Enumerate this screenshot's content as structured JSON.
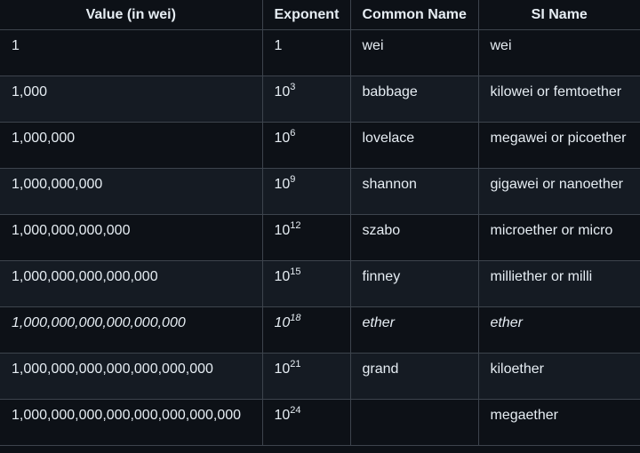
{
  "table": {
    "headers": [
      "Value (in wei)",
      "Exponent",
      "Common Name",
      "SI Name"
    ],
    "rows": [
      {
        "value": "1",
        "exp_base": "1",
        "exp_power": "",
        "common": "wei",
        "si": "wei",
        "emphasis": false
      },
      {
        "value": "1,000",
        "exp_base": "10",
        "exp_power": "3",
        "common": "babbage",
        "si": "kilowei or femtoether",
        "emphasis": false
      },
      {
        "value": "1,000,000",
        "exp_base": "10",
        "exp_power": "6",
        "common": "lovelace",
        "si": "megawei or picoether",
        "emphasis": false
      },
      {
        "value": "1,000,000,000",
        "exp_base": "10",
        "exp_power": "9",
        "common": "shannon",
        "si": "gigawei or nanoether",
        "emphasis": false
      },
      {
        "value": "1,000,000,000,000",
        "exp_base": "10",
        "exp_power": "12",
        "common": "szabo",
        "si": "microether or micro",
        "emphasis": false
      },
      {
        "value": "1,000,000,000,000,000",
        "exp_base": "10",
        "exp_power": "15",
        "common": "finney",
        "si": "milliether or milli",
        "emphasis": false
      },
      {
        "value": "1,000,000,000,000,000,000",
        "exp_base": "10",
        "exp_power": "18",
        "common": "ether",
        "si": "ether",
        "emphasis": true
      },
      {
        "value": "1,000,000,000,000,000,000,000",
        "exp_base": "10",
        "exp_power": "21",
        "common": "grand",
        "si": "kiloether",
        "emphasis": false
      },
      {
        "value": "1,000,000,000,000,000,000,000,000",
        "exp_base": "10",
        "exp_power": "24",
        "common": "",
        "si": "megaether",
        "emphasis": false
      }
    ]
  },
  "colors": {
    "background": "#0d1117",
    "row_alt": "#151b23",
    "border": "#3d444d",
    "text": "#e6edf3"
  }
}
